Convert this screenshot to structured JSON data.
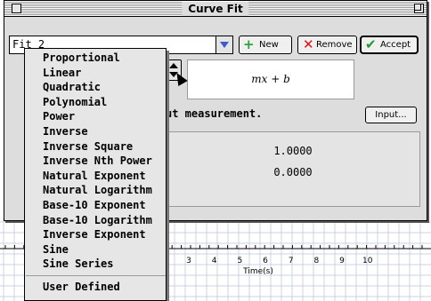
{
  "window": {
    "title": "Curve Fit"
  },
  "fit_selector": {
    "value": "Fit 2"
  },
  "toolbar": {
    "new_label": "New",
    "new_icon": "plus-icon",
    "remove_label": "Remove",
    "remove_icon": "x-icon",
    "accept_label": "Accept",
    "accept_icon": "checkmark-icon",
    "colors": {
      "new_icon": "#2aa33a",
      "remove_icon": "#e01010",
      "accept_icon": "#1e9a2e"
    }
  },
  "formula": "mx + b",
  "hint": "ut measurement.",
  "input_button": "Input...",
  "parameters": {
    "m": "1.0000",
    "b": "0.0000"
  },
  "fit_menu": {
    "items": [
      "Proportional",
      "Linear",
      "Quadratic",
      "Polynomial",
      "Power",
      "Inverse",
      "Inverse Square",
      "Inverse Nth Power",
      "Natural Exponent",
      "Natural Logarithm",
      "Base-10 Exponent",
      "Base-10 Logarithm",
      "Inverse Exponent",
      "Sine",
      "Sine Series",
      "User Defined"
    ]
  },
  "graph": {
    "x_ticks": [
      "3",
      "4",
      "5",
      "6",
      "7",
      "8",
      "9",
      "10"
    ],
    "x_label": "Time(s)"
  }
}
